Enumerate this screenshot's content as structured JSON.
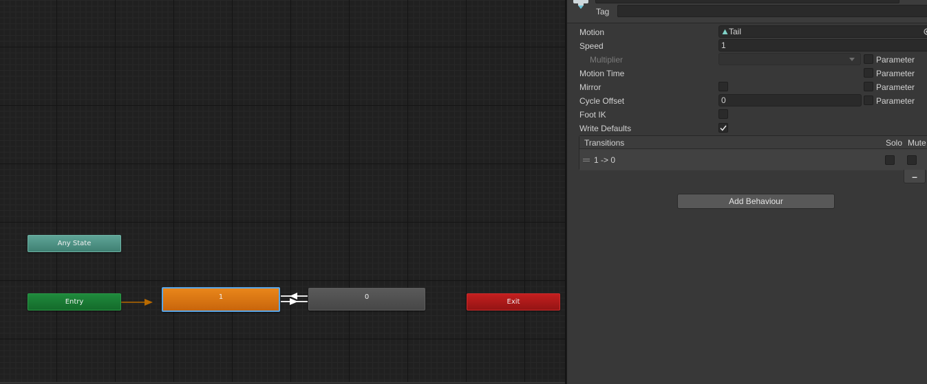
{
  "graph": {
    "nodes": {
      "any_state": "Any State",
      "entry": "Entry",
      "state_1": "1",
      "state_0": "0",
      "exit": "Exit"
    },
    "colors": {
      "any_state": "#4f9385",
      "entry": "#187a33",
      "selected_state": "#d8750f",
      "default_state": "#505050",
      "exit": "#ab1a1a",
      "selection_outline": "#59a6e8",
      "entry_arrow": "#b86a00",
      "transition_arrow": "#ffffff"
    }
  },
  "inspector": {
    "tag_label": "Tag",
    "tag_value": "",
    "motion": {
      "label": "Motion",
      "value": "Tail",
      "icon": "animation-clip-icon"
    },
    "speed": {
      "label": "Speed",
      "value": "1"
    },
    "multiplier": {
      "label": "Multiplier",
      "value": "",
      "param_label": "Parameter"
    },
    "motion_time": {
      "label": "Motion Time",
      "param_label": "Parameter"
    },
    "mirror": {
      "label": "Mirror",
      "checked": false,
      "param_label": "Parameter"
    },
    "cycle_offset": {
      "label": "Cycle Offset",
      "value": "0",
      "param_label": "Parameter"
    },
    "foot_ik": {
      "label": "Foot IK",
      "checked": false
    },
    "write_defaults": {
      "label": "Write Defaults",
      "checked": true
    },
    "transitions": {
      "title": "Transitions",
      "solo_label": "Solo",
      "mute_label": "Mute",
      "rows": [
        {
          "label": "1 -> 0",
          "solo": false,
          "mute": false
        }
      ]
    },
    "remove_button": "–",
    "add_behaviour": "Add Behaviour"
  }
}
